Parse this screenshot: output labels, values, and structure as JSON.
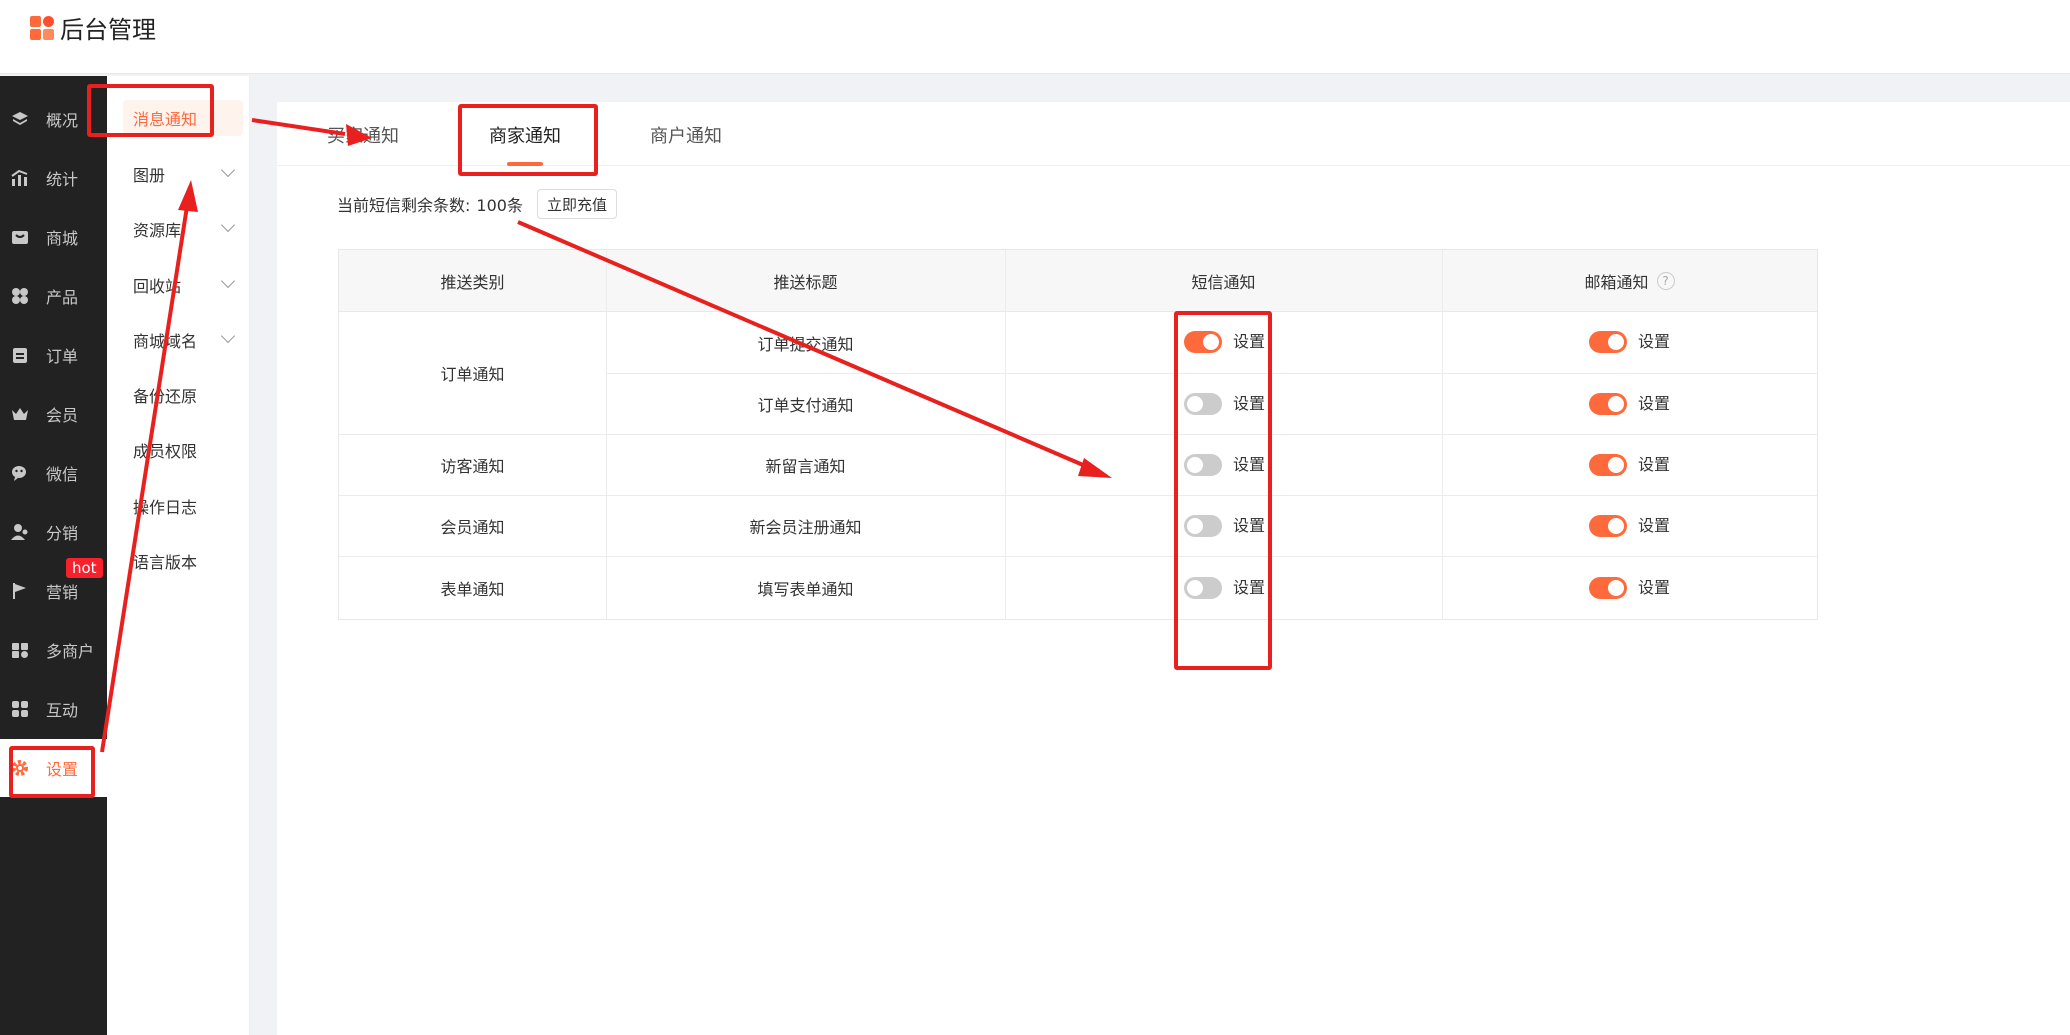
{
  "header": {
    "title": "后台管理"
  },
  "sidebar": {
    "items": [
      {
        "label": "概况",
        "icon": "layers-icon"
      },
      {
        "label": "统计",
        "icon": "chart-icon"
      },
      {
        "label": "商城",
        "icon": "mall-icon"
      },
      {
        "label": "产品",
        "icon": "product-icon"
      },
      {
        "label": "订单",
        "icon": "clipboard-icon"
      },
      {
        "label": "会员",
        "icon": "crown-icon"
      },
      {
        "label": "微信",
        "icon": "wechat-icon"
      },
      {
        "label": "分销",
        "icon": "users-icon"
      },
      {
        "label": "营销",
        "icon": "flag-icon",
        "badge": "hot"
      },
      {
        "label": "多商户",
        "icon": "store-icon"
      },
      {
        "label": "互动",
        "icon": "interact-icon"
      },
      {
        "label": "设置",
        "icon": "gear-icon",
        "active": true
      }
    ]
  },
  "subnav": {
    "items": [
      {
        "label": "消息通知",
        "active": true
      },
      {
        "label": "图册",
        "expandable": true
      },
      {
        "label": "资源库",
        "expandable": true
      },
      {
        "label": "回收站",
        "expandable": true
      },
      {
        "label": "商城域名",
        "expandable": true
      },
      {
        "label": "备份还原"
      },
      {
        "label": "成员权限"
      },
      {
        "label": "操作日志"
      },
      {
        "label": "语言版本"
      }
    ]
  },
  "tabs": [
    {
      "label": "买家通知"
    },
    {
      "label": "商家通知",
      "active": true
    },
    {
      "label": "商户通知"
    }
  ],
  "sms": {
    "label": "当前短信剩余条数:",
    "count": "100条",
    "recharge_label": "立即充值"
  },
  "table": {
    "headers": {
      "category": "推送类别",
      "title": "推送标题",
      "sms": "短信通知",
      "email": "邮箱通知",
      "email_help": "?"
    },
    "groups": [
      {
        "category": "订单通知"
      },
      {
        "category": "访客通知"
      },
      {
        "category": "会员通知"
      },
      {
        "category": "表单通知"
      }
    ],
    "rows": [
      {
        "title": "订单提交通知",
        "sms_on": true,
        "email_on": true,
        "sms_action": "设置",
        "email_action": "设置"
      },
      {
        "title": "订单支付通知",
        "sms_on": false,
        "email_on": true,
        "sms_action": "设置",
        "email_action": "设置"
      },
      {
        "title": "新留言通知",
        "sms_on": false,
        "email_on": true,
        "sms_action": "设置",
        "email_action": "设置"
      },
      {
        "title": "新会员注册通知",
        "sms_on": false,
        "email_on": true,
        "sms_action": "设置",
        "email_action": "设置"
      },
      {
        "title": "填写表单通知",
        "sms_on": false,
        "email_on": true,
        "sms_action": "设置",
        "email_action": "设置"
      }
    ]
  },
  "colors": {
    "accent": "#ff6a3d",
    "annotation": "#e8201e",
    "sidebar_bg": "#222222"
  }
}
